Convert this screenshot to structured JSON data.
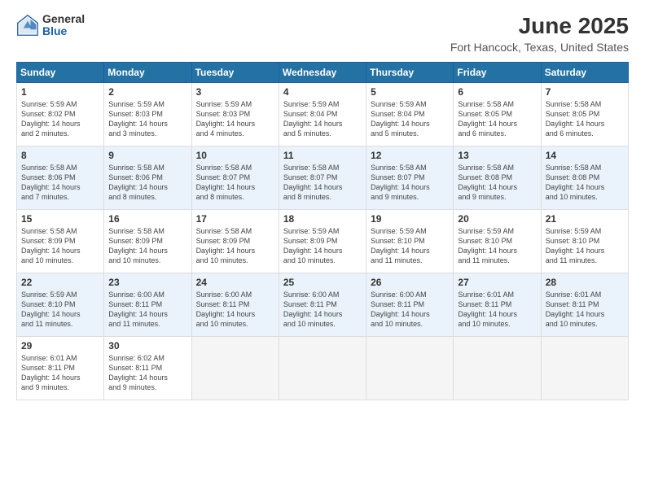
{
  "logo": {
    "general": "General",
    "blue": "Blue"
  },
  "header": {
    "title": "June 2025",
    "subtitle": "Fort Hancock, Texas, United States"
  },
  "weekdays": [
    "Sunday",
    "Monday",
    "Tuesday",
    "Wednesday",
    "Thursday",
    "Friday",
    "Saturday"
  ],
  "weeks": [
    [
      {
        "day": "1",
        "info": "Sunrise: 5:59 AM\nSunset: 8:02 PM\nDaylight: 14 hours\nand 2 minutes."
      },
      {
        "day": "2",
        "info": "Sunrise: 5:59 AM\nSunset: 8:03 PM\nDaylight: 14 hours\nand 3 minutes."
      },
      {
        "day": "3",
        "info": "Sunrise: 5:59 AM\nSunset: 8:03 PM\nDaylight: 14 hours\nand 4 minutes."
      },
      {
        "day": "4",
        "info": "Sunrise: 5:59 AM\nSunset: 8:04 PM\nDaylight: 14 hours\nand 5 minutes."
      },
      {
        "day": "5",
        "info": "Sunrise: 5:59 AM\nSunset: 8:04 PM\nDaylight: 14 hours\nand 5 minutes."
      },
      {
        "day": "6",
        "info": "Sunrise: 5:58 AM\nSunset: 8:05 PM\nDaylight: 14 hours\nand 6 minutes."
      },
      {
        "day": "7",
        "info": "Sunrise: 5:58 AM\nSunset: 8:05 PM\nDaylight: 14 hours\nand 6 minutes."
      }
    ],
    [
      {
        "day": "8",
        "info": "Sunrise: 5:58 AM\nSunset: 8:06 PM\nDaylight: 14 hours\nand 7 minutes."
      },
      {
        "day": "9",
        "info": "Sunrise: 5:58 AM\nSunset: 8:06 PM\nDaylight: 14 hours\nand 8 minutes."
      },
      {
        "day": "10",
        "info": "Sunrise: 5:58 AM\nSunset: 8:07 PM\nDaylight: 14 hours\nand 8 minutes."
      },
      {
        "day": "11",
        "info": "Sunrise: 5:58 AM\nSunset: 8:07 PM\nDaylight: 14 hours\nand 8 minutes."
      },
      {
        "day": "12",
        "info": "Sunrise: 5:58 AM\nSunset: 8:07 PM\nDaylight: 14 hours\nand 9 minutes."
      },
      {
        "day": "13",
        "info": "Sunrise: 5:58 AM\nSunset: 8:08 PM\nDaylight: 14 hours\nand 9 minutes."
      },
      {
        "day": "14",
        "info": "Sunrise: 5:58 AM\nSunset: 8:08 PM\nDaylight: 14 hours\nand 10 minutes."
      }
    ],
    [
      {
        "day": "15",
        "info": "Sunrise: 5:58 AM\nSunset: 8:09 PM\nDaylight: 14 hours\nand 10 minutes."
      },
      {
        "day": "16",
        "info": "Sunrise: 5:58 AM\nSunset: 8:09 PM\nDaylight: 14 hours\nand 10 minutes."
      },
      {
        "day": "17",
        "info": "Sunrise: 5:58 AM\nSunset: 8:09 PM\nDaylight: 14 hours\nand 10 minutes."
      },
      {
        "day": "18",
        "info": "Sunrise: 5:59 AM\nSunset: 8:09 PM\nDaylight: 14 hours\nand 10 minutes."
      },
      {
        "day": "19",
        "info": "Sunrise: 5:59 AM\nSunset: 8:10 PM\nDaylight: 14 hours\nand 11 minutes."
      },
      {
        "day": "20",
        "info": "Sunrise: 5:59 AM\nSunset: 8:10 PM\nDaylight: 14 hours\nand 11 minutes."
      },
      {
        "day": "21",
        "info": "Sunrise: 5:59 AM\nSunset: 8:10 PM\nDaylight: 14 hours\nand 11 minutes."
      }
    ],
    [
      {
        "day": "22",
        "info": "Sunrise: 5:59 AM\nSunset: 8:10 PM\nDaylight: 14 hours\nand 11 minutes."
      },
      {
        "day": "23",
        "info": "Sunrise: 6:00 AM\nSunset: 8:11 PM\nDaylight: 14 hours\nand 11 minutes."
      },
      {
        "day": "24",
        "info": "Sunrise: 6:00 AM\nSunset: 8:11 PM\nDaylight: 14 hours\nand 10 minutes."
      },
      {
        "day": "25",
        "info": "Sunrise: 6:00 AM\nSunset: 8:11 PM\nDaylight: 14 hours\nand 10 minutes."
      },
      {
        "day": "26",
        "info": "Sunrise: 6:00 AM\nSunset: 8:11 PM\nDaylight: 14 hours\nand 10 minutes."
      },
      {
        "day": "27",
        "info": "Sunrise: 6:01 AM\nSunset: 8:11 PM\nDaylight: 14 hours\nand 10 minutes."
      },
      {
        "day": "28",
        "info": "Sunrise: 6:01 AM\nSunset: 8:11 PM\nDaylight: 14 hours\nand 10 minutes."
      }
    ],
    [
      {
        "day": "29",
        "info": "Sunrise: 6:01 AM\nSunset: 8:11 PM\nDaylight: 14 hours\nand 9 minutes."
      },
      {
        "day": "30",
        "info": "Sunrise: 6:02 AM\nSunset: 8:11 PM\nDaylight: 14 hours\nand 9 minutes."
      },
      {
        "day": "",
        "info": ""
      },
      {
        "day": "",
        "info": ""
      },
      {
        "day": "",
        "info": ""
      },
      {
        "day": "",
        "info": ""
      },
      {
        "day": "",
        "info": ""
      }
    ]
  ]
}
